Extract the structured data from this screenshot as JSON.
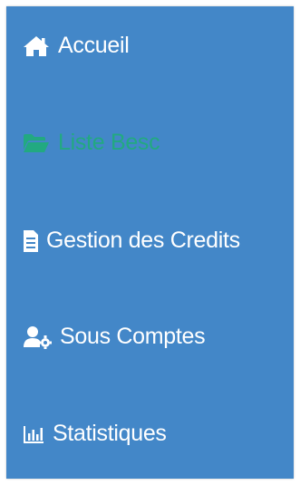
{
  "colors": {
    "sidebar_bg": "#4387c8",
    "item_text": "#ffffff",
    "active_text": "#22a981"
  },
  "sidebar": {
    "items": [
      {
        "label": "Accueil",
        "icon": "home-icon",
        "active": false
      },
      {
        "label": "Liste Besc",
        "icon": "folder-open-icon",
        "active": true
      },
      {
        "label": "Gestion des Credits",
        "icon": "file-document-icon",
        "active": false
      },
      {
        "label": "Sous Comptes",
        "icon": "user-gear-icon",
        "active": false
      },
      {
        "label": "Statistiques",
        "icon": "bar-chart-icon",
        "active": false
      }
    ]
  }
}
